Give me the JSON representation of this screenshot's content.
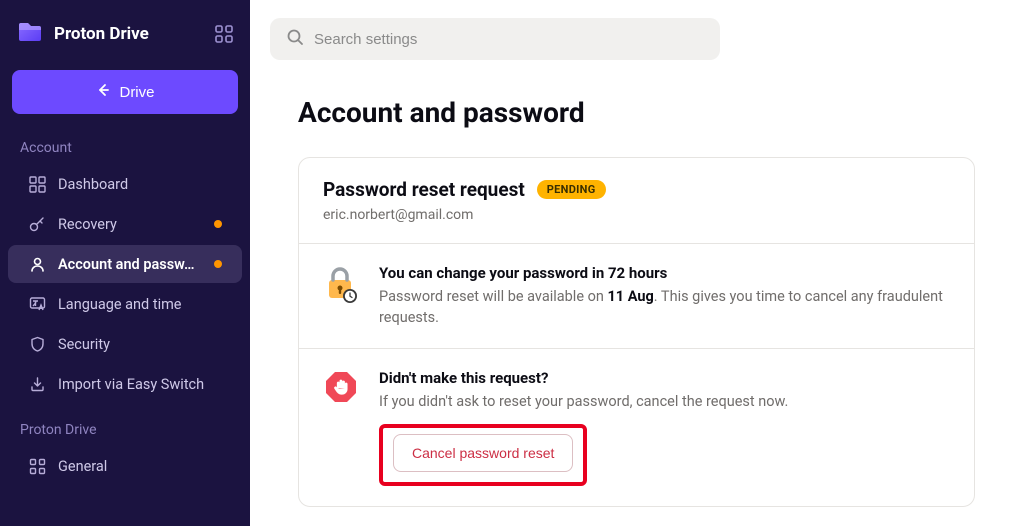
{
  "app": {
    "name": "Proton Drive"
  },
  "sidebar": {
    "drive_label": "Drive",
    "sections": {
      "account": {
        "label": "Account",
        "items": [
          {
            "label": "Dashboard"
          },
          {
            "label": "Recovery"
          },
          {
            "label": "Account and passw…"
          },
          {
            "label": "Language and time"
          },
          {
            "label": "Security"
          },
          {
            "label": "Import via Easy Switch"
          }
        ]
      },
      "drive": {
        "label": "Proton Drive",
        "items": [
          {
            "label": "General"
          }
        ]
      }
    }
  },
  "search": {
    "placeholder": "Search settings"
  },
  "page": {
    "title": "Account and password",
    "reset_card": {
      "title": "Password reset request",
      "badge": "PENDING",
      "email": "eric.norbert@gmail.com"
    },
    "wait_block": {
      "title": "You can change your password in 72 hours",
      "text_prefix": "Password reset will be available on ",
      "date": "11 Aug",
      "text_suffix": ". This gives you time to cancel any fraudulent requests."
    },
    "cancel_block": {
      "title": "Didn't make this request?",
      "text": "If you didn't ask to reset your password, cancel the request now.",
      "button": "Cancel password reset"
    }
  }
}
